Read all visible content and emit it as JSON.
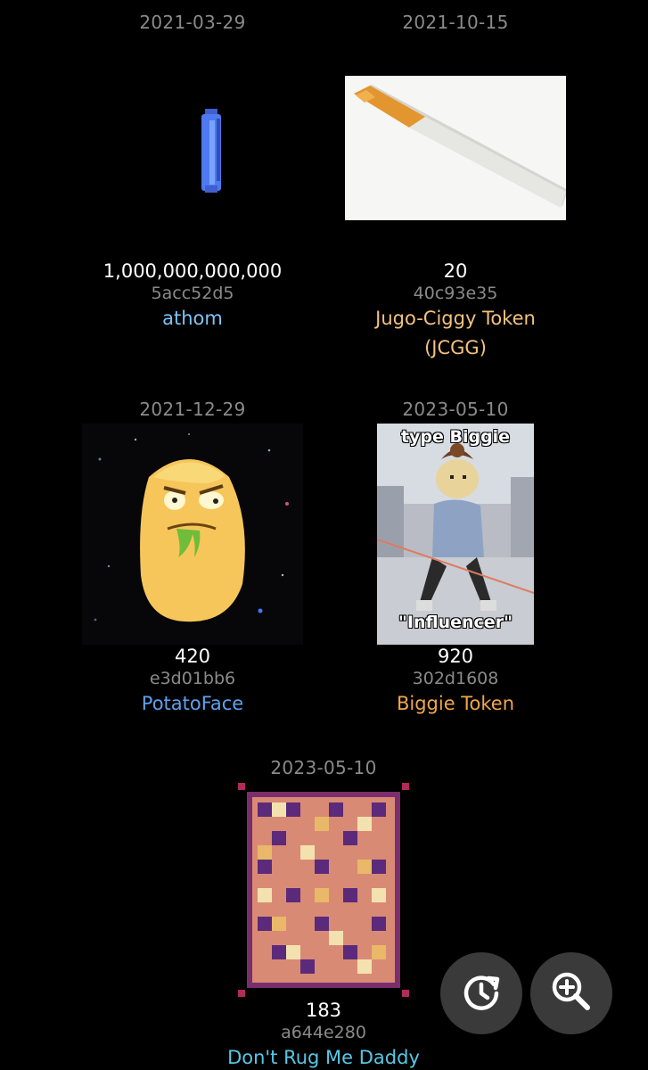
{
  "items": [
    {
      "date": "2021-03-29",
      "amount": "1,000,000,000,000",
      "hash": "5acc52d5",
      "name": "athom",
      "name_color": "#7ec4f5",
      "image": "blue-pixel-capsule"
    },
    {
      "date": "2021-10-15",
      "amount": "20",
      "hash": "40c93e35",
      "name": "Jugo-Ciggy Token (JCGG)",
      "name_color": "#f2c27e",
      "image": "cigarette"
    },
    {
      "date": "2021-12-29",
      "amount": "420",
      "hash": "e3d01bb6",
      "name": "PotatoFace",
      "name_color": "#5ea2ee",
      "image": "potato-face-in-space"
    },
    {
      "date": "2023-05-10",
      "amount": "920",
      "hash": "302d1608",
      "name": "Biggie Token",
      "name_color": "#f0a64c",
      "image": "biggie-influencer-meme",
      "image_caption_top": "type Biggie",
      "image_caption_bottom": "\"Influencer\""
    },
    {
      "date": "2023-05-10",
      "amount": "183",
      "hash": "a644e280",
      "name": "Don't Rug Me Daddy",
      "name_color": "#56c8e6",
      "image": "pixel-romo-art"
    }
  ],
  "fab": {
    "history_icon": "history-icon",
    "zoom_icon": "zoom-in-icon",
    "background": "#3a3a3a"
  }
}
